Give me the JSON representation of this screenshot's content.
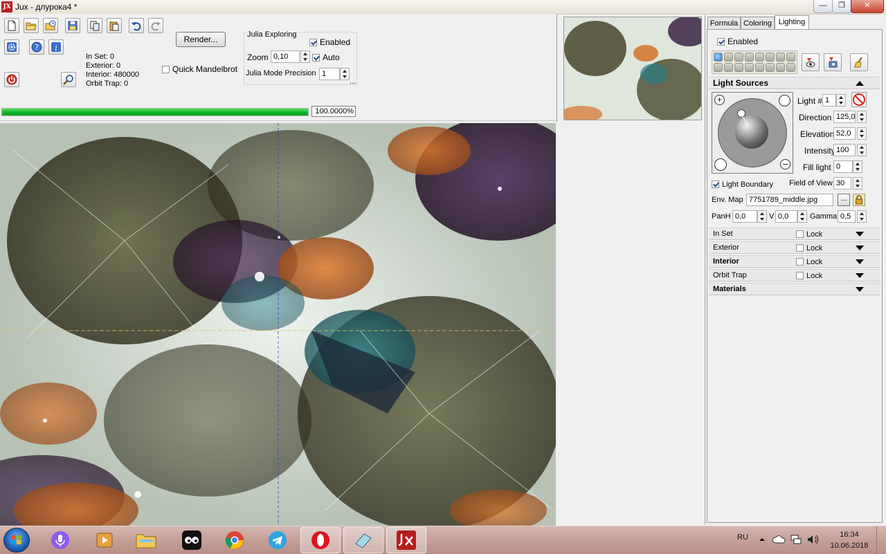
{
  "window": {
    "title": "Jux - длурока4 *",
    "app_icon_text": "JX"
  },
  "toolbar": {
    "render_label": "Render...",
    "stats": {
      "in_set": "In Set: 0",
      "exterior": "Exterior: 0",
      "interior": "Interior: 480000",
      "orbit_trap": "Orbit Trap: 0"
    },
    "quick_mandelbrot_label": "Quick Mandelbrot",
    "quick_mandelbrot_checked": false,
    "julia": {
      "group_label": "Julia Exploring",
      "enabled_label": "Enabled",
      "zoom_label": "Zoom",
      "zoom_value": "0,10",
      "auto_label": "Auto",
      "precision_label": "Julia Mode Precision",
      "precision_value": "1",
      "more": "..."
    },
    "progress": {
      "value": 100,
      "text": "100.0000%"
    }
  },
  "right_panel": {
    "tabs": [
      {
        "label": "Formula",
        "active": false
      },
      {
        "label": "Coloring",
        "active": false
      },
      {
        "label": "Lighting",
        "active": true
      }
    ],
    "enabled_label": "Enabled",
    "light_sources": {
      "header": "Light Sources",
      "light_num_label": "Light #",
      "light_num_value": "1",
      "direction_label": "Direction",
      "direction_value": "125,0",
      "elevation_label": "Elevation",
      "elevation_value": "52,0",
      "intensity_label": "Intensity",
      "intensity_value": "100",
      "fill_light_label": "Fill light",
      "fill_light_value": "0",
      "light_boundary_label": "Light Boundary",
      "fov_label": "Field of View",
      "fov_value": "30",
      "env_map_label": "Env. Map",
      "env_map_value": "7751789_middle.jpg",
      "browse_label": "...",
      "panh_label": "PanH",
      "panh_value": "0,0",
      "v_label": "V",
      "v_value": "0,0",
      "gamma_label": "Gamma",
      "gamma_value": "0,5"
    },
    "sections": [
      {
        "label": "In Set",
        "lock_label": "Lock",
        "bold": false
      },
      {
        "label": "Exterior",
        "lock_label": "Lock",
        "bold": false
      },
      {
        "label": "Interior",
        "lock_label": "Lock",
        "bold": true
      },
      {
        "label": "Orbit Trap",
        "lock_label": "Lock",
        "bold": false
      },
      {
        "label": "Materials",
        "lock_label": "",
        "bold": true
      }
    ]
  },
  "taskbar": {
    "language": "RU",
    "time": "16:34",
    "date": "10.06.2018"
  },
  "colors": {
    "progress": "#06b025",
    "accent_red": "#b51e1e",
    "taskbar": "#c4a098"
  }
}
